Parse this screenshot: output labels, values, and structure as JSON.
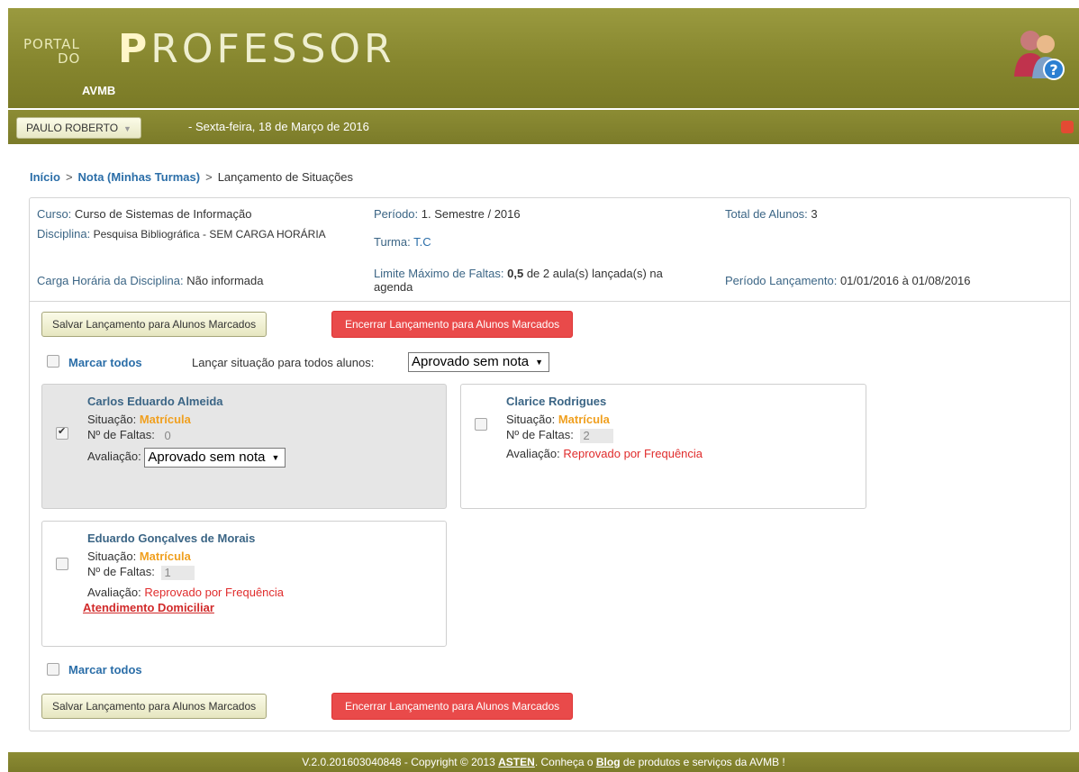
{
  "header": {
    "logo_small_line1": "PORTAL",
    "logo_small_line2": "DO",
    "logo_big_first": "P",
    "logo_big_rest": "ROFESSOR",
    "logo_sub": "AVMB",
    "user_name": "PAULO ROBERTO",
    "date": "- Sexta-feira, 18 de Março de 2016",
    "icons": [
      "users-help-icon",
      "power-icon",
      "chevron-down-icon"
    ]
  },
  "breadcrumb": {
    "home": "Início",
    "sep1": ">",
    "turmas": "Nota (Minhas Turmas)",
    "sep2": ">",
    "current": "Lançamento de Situações"
  },
  "info": {
    "curso_label": "Curso:",
    "curso": "Curso de Sistemas de Informação",
    "periodo_label": "Período:",
    "periodo": "1. Semestre / 2016",
    "total_label": "Total de Alunos:",
    "total": "3",
    "disciplina_label": "Disciplina:",
    "disciplina": "Pesquisa Bibliográfica - SEM CARGA HORÁRIA",
    "turma_label": "Turma:",
    "turma": "T.C",
    "carga_label": "Carga Horária da Disciplina:",
    "carga": "Não informada",
    "limite_label": "Limite Máximo de Faltas:",
    "limite_val": "0,5",
    "limite_rest": "de 2 aula(s) lançada(s) na agenda",
    "periodo_lanc_label": "Período Lançamento:",
    "periodo_lanc": "01/01/2016 à 01/08/2016"
  },
  "actions": {
    "save_label": "Salvar Lançamento para Alunos Marcados",
    "end_label": "Encerrar Lançamento para Alunos Marcados",
    "mark_all": "Marcar todos",
    "launch_all_label": "Lançar situação para todos alunos:",
    "launch_all_value": "Aprovado sem nota"
  },
  "students": [
    {
      "name": "Carlos Eduardo Almeida",
      "checked": true,
      "situacao_label": "Situação:",
      "situacao": "Matrícula",
      "faltas_label": "Nº de Faltas:",
      "faltas": "0",
      "avaliacao_label": "Avaliação:",
      "avaliacao": "Aprovado sem nota"
    },
    {
      "name": "Clarice Rodrigues",
      "checked": false,
      "situacao_label": "Situação:",
      "situacao": "Matrícula",
      "faltas_label": "Nº de Faltas:",
      "faltas": "2",
      "avaliacao_label": "Avaliação:",
      "avaliacao": "Reprovado por Frequência"
    },
    {
      "name": "Eduardo Gonçalves de Morais",
      "checked": false,
      "situacao_label": "Situação:",
      "situacao": "Matrícula",
      "faltas_label": "Nº de Faltas:",
      "faltas": "1",
      "avaliacao_label": "Avaliação:",
      "avaliacao": "Reprovado por Frequência",
      "extra_link": "Atendimento Domiciliar"
    }
  ],
  "footer": {
    "text1": "V.2.0.201603040848 - Copyright © 2013",
    "asten": "ASTEN",
    "text2": ". Conheça o",
    "blog": "Blog",
    "text3": "de produtos e serviços da AVMB !"
  }
}
